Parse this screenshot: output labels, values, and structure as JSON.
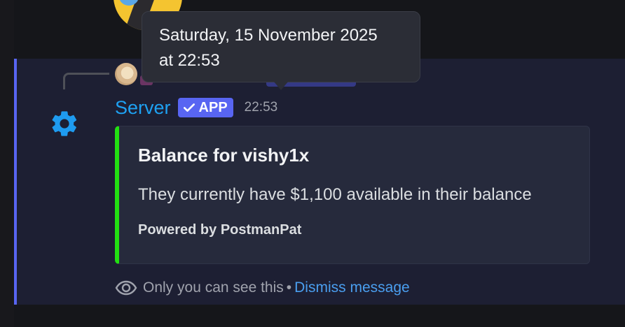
{
  "message": {
    "author": "Server",
    "app_badge": "APP",
    "timestamp": "22:53",
    "tooltip_line1": "Saturday, 15 November 2025",
    "tooltip_line2": "at 22:53"
  },
  "embed": {
    "title": "Balance for vishy1x",
    "description": "They currently have $1,100 available in their balance",
    "footer": "Powered by PostmanPat",
    "accent_color": "#22e012"
  },
  "ephemeral": {
    "notice": "Only you can see this",
    "separator": "•",
    "dismiss_label": "Dismiss message"
  },
  "icons": {
    "author_avatar": "gear-icon",
    "badge_check": "checkmark-icon",
    "ephemeral": "eye-icon"
  },
  "colors": {
    "author_name": "#1ea1f2",
    "app_badge": "#5865f2",
    "link": "#4a9ff0",
    "message_highlight": "#1d1f33"
  }
}
